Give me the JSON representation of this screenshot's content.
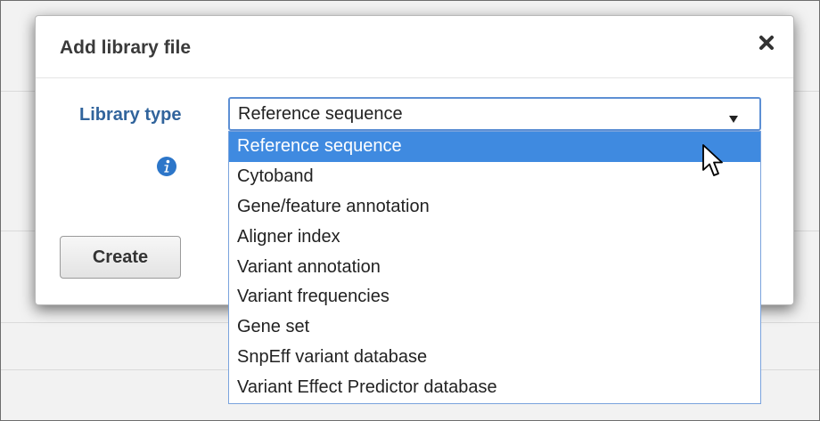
{
  "dialog": {
    "title": "Add library file",
    "close_icon": "close-x-icon"
  },
  "form": {
    "library_type_label": "Library type",
    "info_icon": "info-icon",
    "create_label": "Create"
  },
  "library_type_select": {
    "selected_value": "Reference sequence",
    "expanded": true,
    "highlighted_index": 0,
    "options": [
      "Reference sequence",
      "Cytoband",
      "Gene/feature annotation",
      "Aligner index",
      "Variant annotation",
      "Variant frequencies",
      "Gene set",
      "SnpEff variant database",
      "Variant Effect Predictor database"
    ]
  },
  "colors": {
    "label_blue": "#31649c",
    "focus_border": "#5d8fd4",
    "highlight": "#3f8ae0",
    "info_icon": "#2c76c9"
  },
  "cursor": "arrow-pointer-icon"
}
